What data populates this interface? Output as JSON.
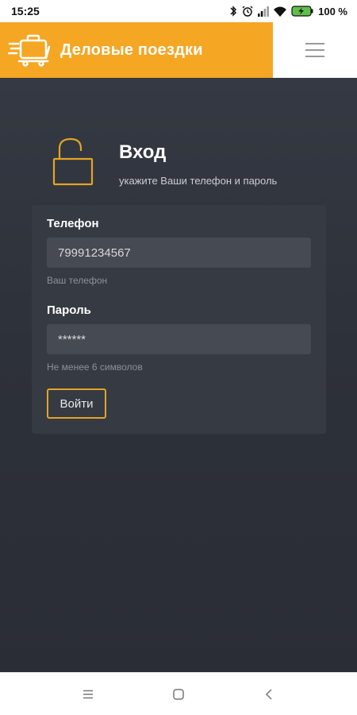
{
  "status_bar": {
    "time": "15:25",
    "battery": "100 %",
    "icons": [
      "bluetooth-icon",
      "alarm-icon",
      "signal-icon",
      "wifi-icon",
      "battery-icon"
    ]
  },
  "app_bar": {
    "title": "Деловые поездки",
    "logo_icon": "suitcase-cart-icon",
    "menu_icon": "hamburger-menu-icon",
    "brand_color": "#f5a623"
  },
  "login": {
    "title": "Вход",
    "subtitle": "укажите Ваши телефон и пароль",
    "icon": "unlocked-padlock-icon",
    "phone": {
      "label": "Телефон",
      "value": "79991234567",
      "hint": "Ваш телефон"
    },
    "password": {
      "label": "Пароль",
      "value": "******",
      "hint": "Не менее 6 символов"
    },
    "submit_label": "Войти",
    "accent_color": "#e3a525"
  },
  "nav_bar": {
    "icons": [
      "recents-icon",
      "home-icon",
      "back-icon"
    ]
  }
}
